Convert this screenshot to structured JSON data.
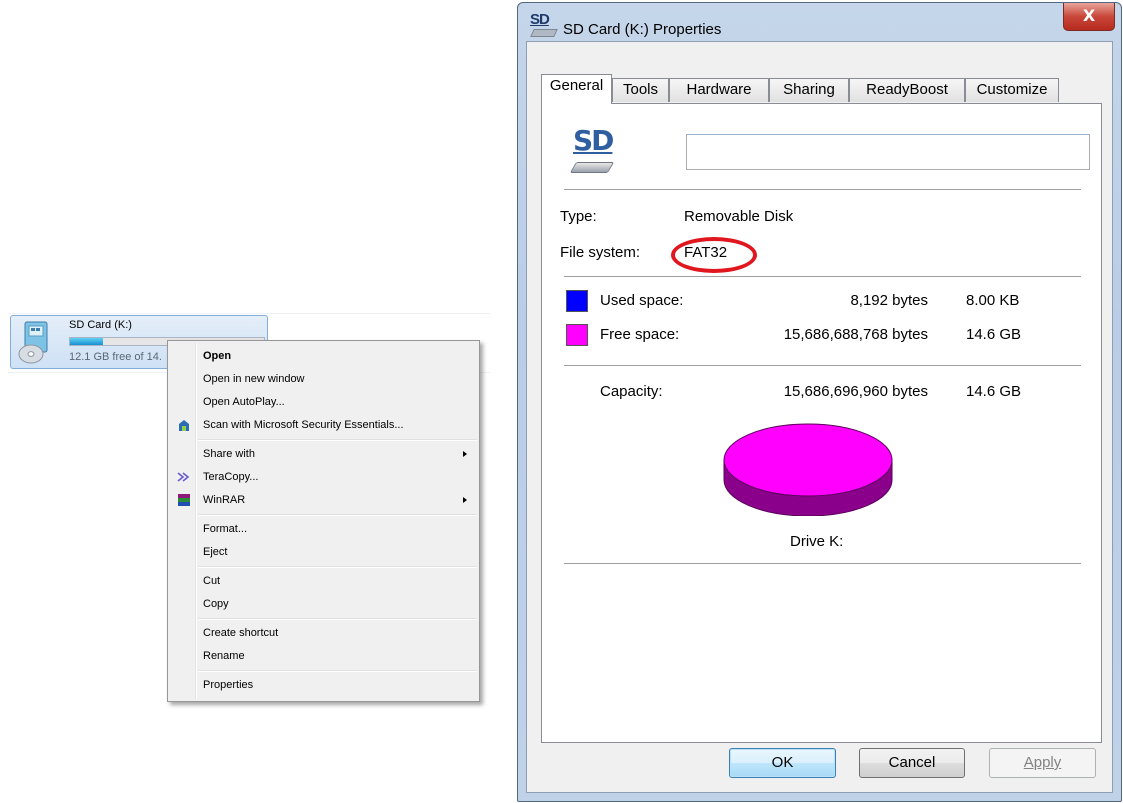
{
  "explorer": {
    "drive_name": "SD Card (K:)",
    "drive_free_text": "12.1 GB free of 14.",
    "drive_bar_fill_percent": 17
  },
  "context_menu": {
    "items": [
      {
        "label": "Open",
        "bold": true
      },
      {
        "label": "Open in new window"
      },
      {
        "label": "Open AutoPlay..."
      },
      {
        "label": "Scan with Microsoft Security Essentials...",
        "icon": "security-essentials-icon"
      },
      {
        "label": "Share with",
        "submenu": true
      },
      {
        "label": "TeraCopy...",
        "icon": "teracopy-icon"
      },
      {
        "label": "WinRAR",
        "icon": "winrar-icon",
        "submenu": true
      },
      {
        "label": "Format..."
      },
      {
        "label": "Eject"
      },
      {
        "label": "Cut"
      },
      {
        "label": "Copy"
      },
      {
        "label": "Create shortcut"
      },
      {
        "label": "Rename"
      },
      {
        "label": "Properties"
      }
    ]
  },
  "dialog": {
    "title": "SD Card (K:) Properties",
    "title_icon_text": "SD",
    "close_glyph": "X",
    "tabs": [
      "General",
      "Tools",
      "Hardware",
      "Sharing",
      "ReadyBoost",
      "Customize"
    ],
    "active_tab": "General",
    "drive_icon_text": "SD",
    "volume_label_value": "",
    "type_label": "Type:",
    "type_value": "Removable Disk",
    "fs_label": "File system:",
    "fs_value": "FAT32",
    "used_label": "Used space:",
    "used_bytes": "8,192 bytes",
    "used_size": "8.00 KB",
    "free_label": "Free space:",
    "free_bytes": "15,686,688,768 bytes",
    "free_size": "14.6 GB",
    "capacity_label": "Capacity:",
    "capacity_bytes": "15,686,696,960 bytes",
    "capacity_size": "14.6 GB",
    "drive_caption": "Drive K:",
    "used_fraction": 5e-07,
    "colors": {
      "used": "#0000ff",
      "free": "#ff00ff",
      "free_side": "#8b008b",
      "highlight": "#e0171e"
    },
    "buttons": {
      "ok": "OK",
      "cancel": "Cancel",
      "apply": "Apply"
    }
  }
}
